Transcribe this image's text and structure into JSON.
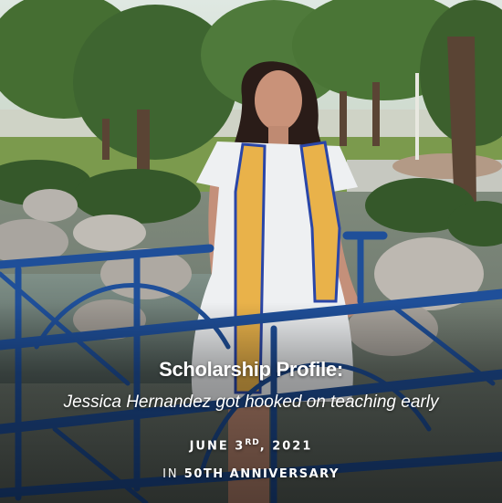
{
  "article": {
    "headline": "Scholarship Profile:",
    "subheadline": "Jessica Hernandez got hooked on teaching early",
    "date_prefix": "JUNE 3",
    "date_suffix": "RD",
    "date_year": ", 2021",
    "category_prefix": "IN",
    "category_link": "50TH ANNIVERSARY"
  },
  "colors": {
    "bridge_rail": "#1f4f99",
    "stole": "#e9b24a",
    "stole_trim": "#2a46a8",
    "dress": "#eef0f2",
    "foliage": "#3e6b2f",
    "sky": "#e8efe6"
  }
}
